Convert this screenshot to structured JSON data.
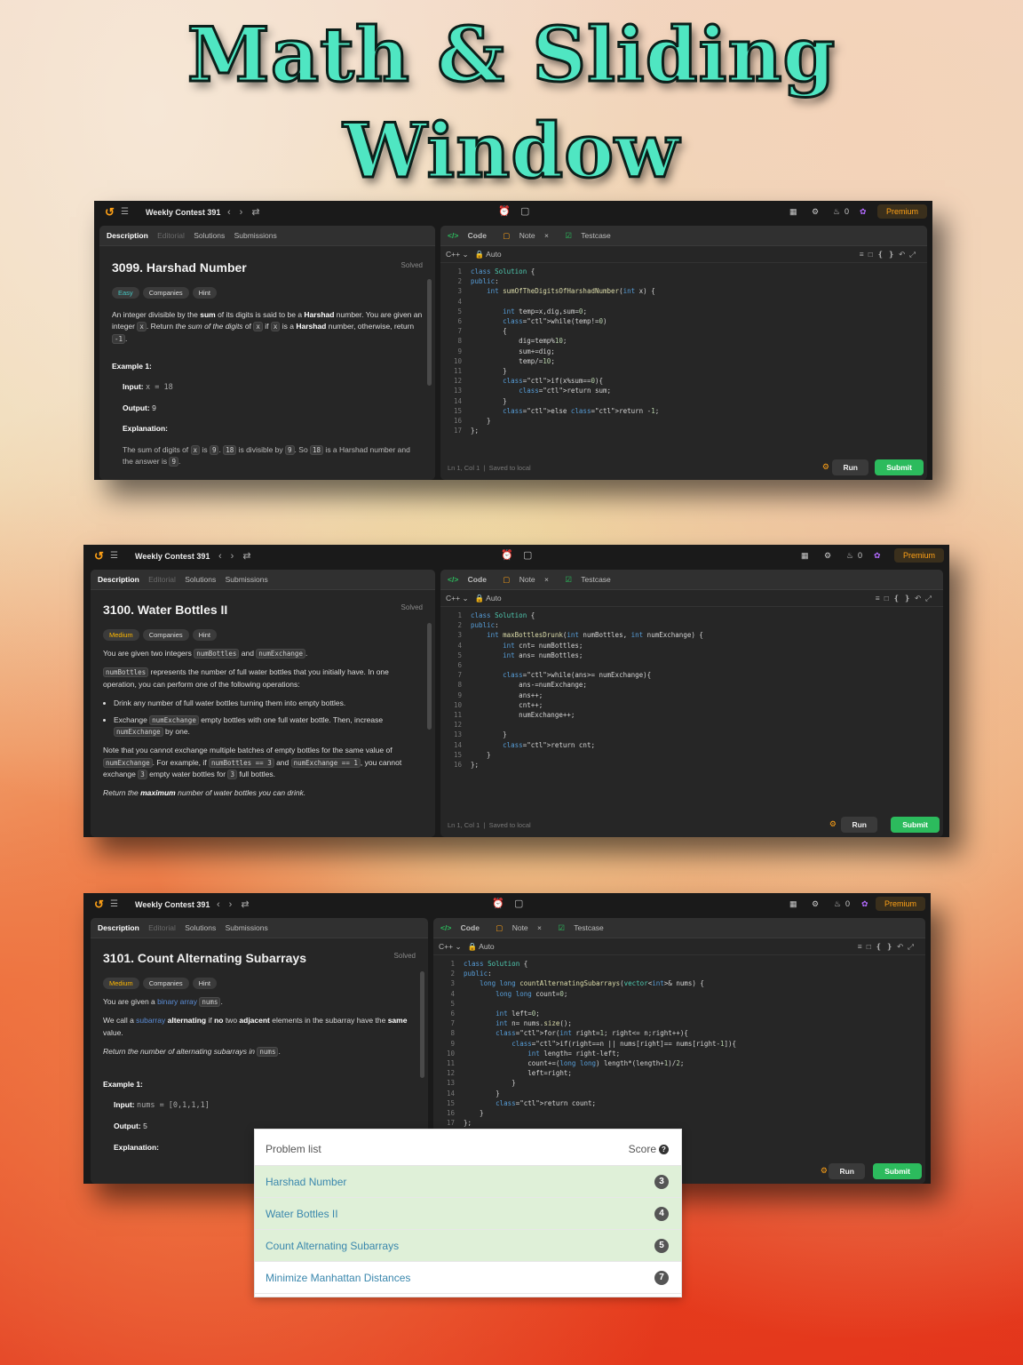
{
  "title": {
    "line1": "Math & Sliding",
    "line2": "Window"
  },
  "common": {
    "contest": "Weekly Contest 391",
    "premium": "Premium",
    "streak": "0",
    "tabs": {
      "description": "Description",
      "editorial": "Editorial",
      "solutions": "Solutions",
      "submissions": "Submissions"
    },
    "right_tabs": {
      "code": "Code",
      "note": "Note",
      "testcase": "Testcase"
    },
    "lang": "C++",
    "auto": "Auto",
    "status": "Ln 1, Col 1",
    "saved": "Saved to local",
    "run": "Run",
    "submit": "Submit",
    "solved": "Solved",
    "companies": "Companies",
    "hint": "Hint"
  },
  "problems": [
    {
      "title": "3099. Harshad Number",
      "difficulty": "Easy",
      "code": [
        "class Solution {",
        "public:",
        "    int sumOfTheDigitsOfHarshadNumber(int x) {",
        "",
        "        int temp=x,dig,sum=0;",
        "        while(temp!=0)",
        "        {",
        "            dig=temp%10;",
        "            sum+=dig;",
        "            temp/=10;",
        "        }",
        "        if(x%sum==0){",
        "            return sum;",
        "        }",
        "        else return -1;",
        "    }",
        "};"
      ]
    },
    {
      "title": "3100. Water Bottles II",
      "difficulty": "Medium",
      "code": [
        "class Solution {",
        "public:",
        "    int maxBottlesDrunk(int numBottles, int numExchange) {",
        "        int cnt= numBottles;",
        "        int ans= numBottles;",
        "",
        "        while(ans>= numExchange){",
        "            ans-=numExchange;",
        "            ans++;",
        "            cnt++;",
        "            numExchange++;",
        "",
        "        }",
        "        return cnt;",
        "    }",
        "};"
      ]
    },
    {
      "title": "3101. Count Alternating Subarrays",
      "difficulty": "Medium",
      "code": [
        "class Solution {",
        "public:",
        "    long long countAlternatingSubarrays(vector<int>& nums) {",
        "        long long count=0;",
        "",
        "        int left=0;",
        "        int n= nums.size();",
        "        for(int right=1; right<= n;right++){",
        "            if(right==n || nums[right]== nums[right-1]){",
        "                int length= right-left;",
        "                count+=(long long) length*(length+1)/2;",
        "                left=right;",
        "            }",
        "        }",
        "        return count;",
        "    }",
        "};"
      ]
    }
  ],
  "desc1": {
    "p1a": "An integer divisible by the ",
    "p1b": "sum",
    "p1c": " of its digits is said to be a ",
    "p1d": "Harshad",
    "p1e": " number. You are given an integer ",
    "p1f": "x",
    "p1g": ". Return ",
    "p1h": "the sum of the digits",
    "p1i": " of ",
    "p1j": "x",
    "p1k": " if ",
    "p1l": "x",
    "p1m": " is a ",
    "p1n": "Harshad",
    "p1o": " number, otherwise, return ",
    "p1p": "-1",
    "p1q": ".",
    "ex": "Example 1:",
    "input_l": "Input:",
    "input_v": "x = 18",
    "output_l": "Output:",
    "output_v": "9",
    "expl_l": "Explanation:",
    "e1": "The sum of digits of ",
    "e2": "x",
    "e3": " is ",
    "e4": "9",
    "e5": ". ",
    "e6": "18",
    "e7": " is divisible by ",
    "e8": "9",
    "e9": ". So ",
    "e10": "18",
    "e11": " is a Harshad number and the answer is ",
    "e12": "9",
    "e13": "."
  },
  "desc2": {
    "l1a": "You are given two integers ",
    "l1b": "numBottles",
    "l1c": " and ",
    "l1d": "numExchange",
    "l1e": ".",
    "l2a": "numBottles",
    "l2b": " represents the number of full water bottles that you initially have. In one operation, you can perform one of the following operations:",
    "b1": "Drink any number of full water bottles turning them into empty bottles.",
    "b2a": "Exchange ",
    "b2b": "numExchange",
    "b2c": " empty bottles with one full water bottle. Then, increase ",
    "b2d": "numExchange",
    "b2e": " by one.",
    "n1": "Note that you cannot exchange multiple batches of empty bottles for the same value of ",
    "n2": "numExchange",
    "n3": ". For example, if ",
    "n4": "numBottles == 3",
    "n5": " and ",
    "n6": "numExchange == 1",
    "n7": ", you cannot exchange ",
    "n8": "3",
    "n9": " empty water bottles for ",
    "n10": "3",
    "n11": " full bottles.",
    "r1": "Return the ",
    "r2": "maximum",
    "r3": " number of water bottles you can drink."
  },
  "desc3": {
    "a1": "You are given a ",
    "a2": "binary array",
    "a3": " ",
    "a4": "nums",
    "a5": ".",
    "c1": "We call a ",
    "c2": "subarray",
    "c3": " ",
    "c4": "alternating",
    "c5": " if ",
    "c6": "no",
    "c7": " two ",
    "c8": "adjacent",
    "c9": " elements in the subarray have the ",
    "c10": "same",
    "c11": " value.",
    "r1": "Return the number of alternating subarrays in ",
    "r2": "nums",
    "r3": ".",
    "ex": "Example 1:",
    "input_l": "Input:",
    "input_v": "nums = [0,1,1,1]",
    "output_l": "Output:",
    "output_v": "5",
    "expl_l": "Explanation:"
  },
  "problem_list": {
    "header": "Problem list",
    "score_label": "Score",
    "rows": [
      {
        "name": "Harshad Number",
        "score": "3",
        "solved": true
      },
      {
        "name": "Water Bottles II",
        "score": "4",
        "solved": true
      },
      {
        "name": "Count Alternating Subarrays",
        "score": "5",
        "solved": true
      },
      {
        "name": "Minimize Manhattan Distances",
        "score": "7",
        "solved": false
      }
    ]
  },
  "colors": {
    "accent": "#ffa116",
    "submit": "#2cbb5d",
    "title": "#4fe6c2",
    "easy": "#46c6c2",
    "medium": "#ffb800"
  }
}
